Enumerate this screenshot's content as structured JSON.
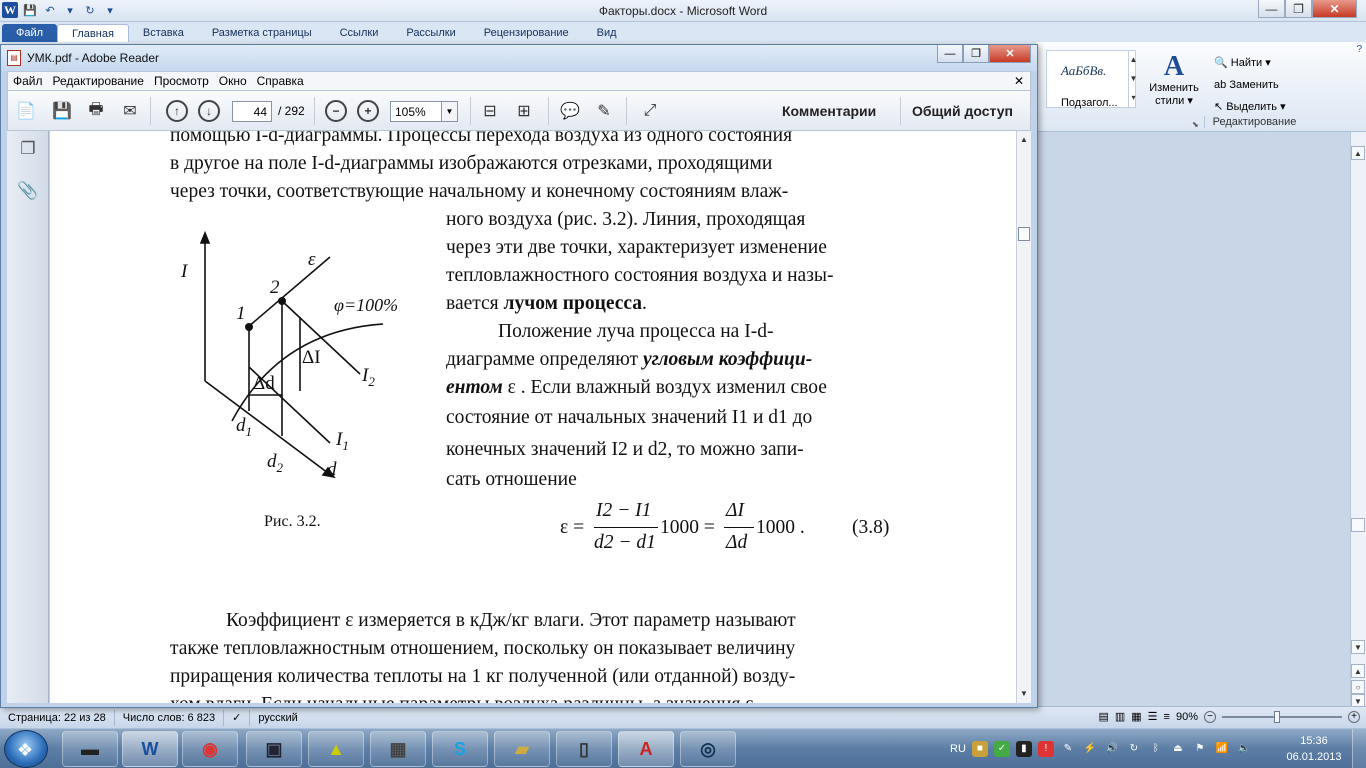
{
  "word": {
    "title": "Факторы.docx - Microsoft Word",
    "tabs": [
      "Файл",
      "Главная",
      "Вставка",
      "Разметка страницы",
      "Ссылки",
      "Рассылки",
      "Рецензирование",
      "Вид"
    ],
    "ribbon": {
      "style_sample": "АаБбВв.",
      "style_name": "Подзагол...",
      "change_styles_line1": "Изменить",
      "change_styles_line2": "стили",
      "find": "Найти",
      "replace": "Заменить",
      "select": "Выделить",
      "group_label": "Редактирование"
    },
    "status": {
      "page": "Страница: 22 из 28",
      "words": "Число слов: 6 823",
      "language": "русский",
      "zoom": "90%"
    }
  },
  "reader": {
    "title": "УМК.pdf - Adobe Reader",
    "menu": [
      "Файл",
      "Редактирование",
      "Просмотр",
      "Окно",
      "Справка"
    ],
    "toolbar": {
      "current_page": "44",
      "total_pages": "/ 292",
      "zoom": "105%",
      "comments": "Комментарии",
      "share": "Общий доступ"
    },
    "page": {
      "lines_top": [
        "помощью I-d-диаграммы. Процессы перехода воздуха из одного состояния",
        "в другое на поле I-d-диаграммы изображаются отрезками, проходящими",
        "через точки, соответствующие начальному и конечному состояниям влаж-"
      ],
      "lines_right": [
        "ного воздуха (рис. 3.2). Линия, проходящая",
        "через эти две точки, характеризует изменение",
        "тепловлажностного состояния воздуха и назы-"
      ],
      "line_beam_pre": "вается ",
      "line_beam_bold": "лучом процесса",
      "line_beam_post": ".",
      "para2_line1": "Положение луча процесса на I-d-",
      "para2_line2_pre": "диаграмме определяют ",
      "para2_line2_bold": "угловым коэффици-",
      "para2_line3_bold": "ентом",
      "para2_line3_post": " ε . Если влажный воздух изменил свое",
      "para2_line4": "состояние от начальных значений I1 и d1 до",
      "para2_line5": "конечных значений I2 и d2, то можно запи-",
      "para2_line6": "сать отношение",
      "figure_caption": "Рис. 3.2.",
      "formula": {
        "eps": "ε =",
        "num1": "I2 − I1",
        "den1": "d2 − d1",
        "mid": "1000 =",
        "num2": "ΔI",
        "den2": "Δd",
        "tail": "1000 .",
        "number": "(3.8)"
      },
      "lines_bottom": [
        "Коэффициент ε измеряется в кДж/кг влаги. Этот параметр называют",
        "также тепловлажностным отношением, поскольку он показывает величину",
        "приращения количества теплоты на 1 кг полученной (или отданной) возду-",
        "хом влаги. Если начальные параметры воздуха различны, а значения ε"
      ],
      "diagram_labels": {
        "I": "I",
        "eps": "ε",
        "p1": "1",
        "p2": "2",
        "phi": "φ=100%",
        "dI": "ΔI",
        "I2": "I",
        "I2_sub": "2",
        "I1": "I",
        "I1_sub": "1",
        "dd": "Δd",
        "d1": "d",
        "d1_sub": "1",
        "d2": "d",
        "d2_sub": "2",
        "d": "d"
      }
    }
  },
  "taskbar": {
    "lang": "RU",
    "time": "15:36",
    "date": "06.01.2013"
  },
  "colors": {
    "word_blue": "#2a5ea8",
    "reader_frame": "#c0d2e9",
    "taskbar": "#5d7ea5"
  }
}
